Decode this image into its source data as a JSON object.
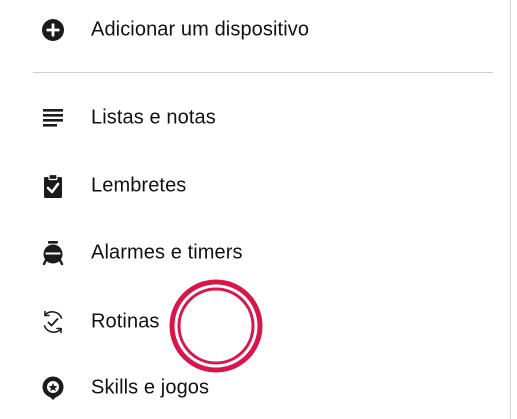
{
  "menu": {
    "add_device": {
      "label": "Adicionar um dispositivo",
      "icon": "plus-circle-icon"
    },
    "items": [
      {
        "label": "Listas e notas",
        "icon": "list-icon"
      },
      {
        "label": "Lembretes",
        "icon": "clipboard-check-icon"
      },
      {
        "label": "Alarmes e timers",
        "icon": "alarm-clock-icon"
      },
      {
        "label": "Rotinas",
        "icon": "routine-refresh-check-icon"
      },
      {
        "label": "Skills e jogos",
        "icon": "skills-badge-icon"
      }
    ]
  },
  "colors": {
    "icon": "#1b1b1b",
    "divider": "#cfcfcf",
    "tap_indicator": "#d9164b"
  }
}
